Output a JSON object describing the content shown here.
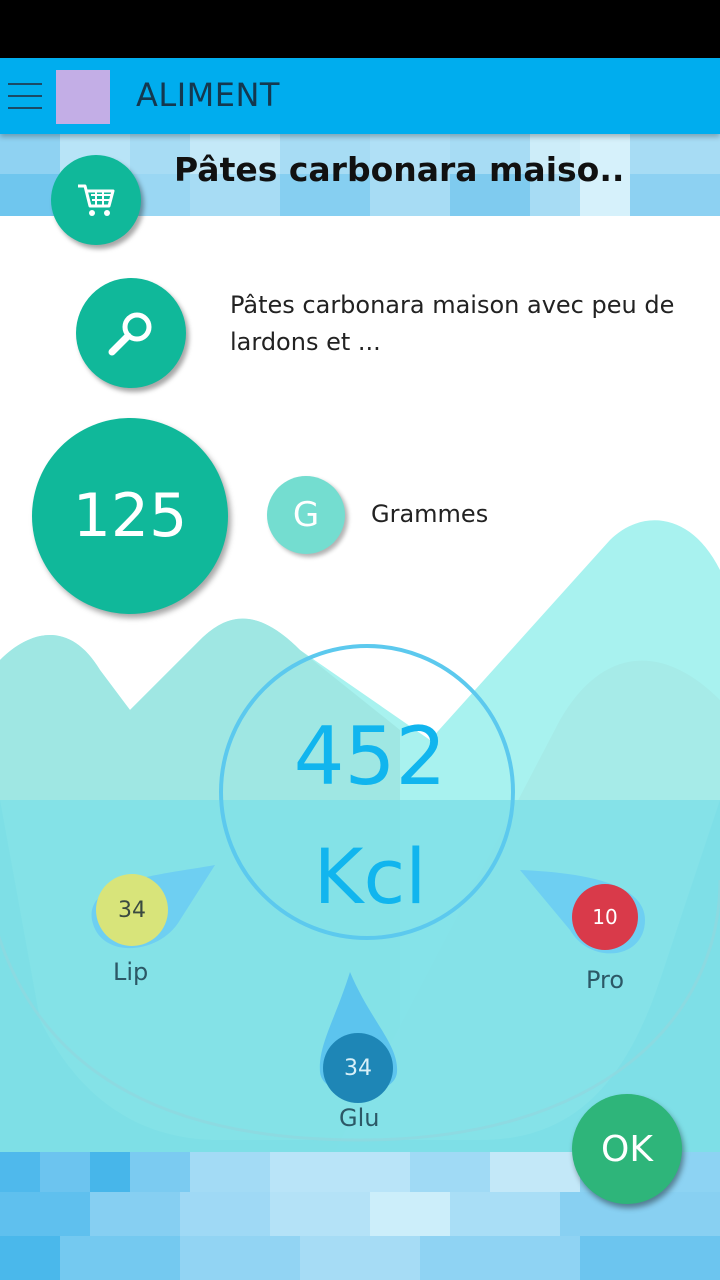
{
  "app_bar": {
    "title": "ALIMENT"
  },
  "food": {
    "title": "Pâtes carbonara maiso..",
    "description": "Pâtes carbonara maison avec peu de lardons et ..."
  },
  "quantity": {
    "value": "125",
    "unit_symbol": "G",
    "unit_label": "Grammes"
  },
  "energy": {
    "value": "452",
    "unit": "Kcl"
  },
  "macros": {
    "lip": {
      "value": "34",
      "label": "Lip",
      "color": "#d8e47a"
    },
    "pro": {
      "value": "10",
      "label": "Pro",
      "color": "#d93a4a"
    },
    "glu": {
      "value": "34",
      "label": "Glu",
      "color": "#1e86b6"
    }
  },
  "actions": {
    "ok_label": "OK"
  },
  "icons": {
    "cart": "cart-icon",
    "search": "search-icon",
    "menu": "menu-icon"
  },
  "colors": {
    "accent": "#00adee",
    "primary": "#10b89a",
    "ok": "#2eb57a",
    "kcal": "#11b5ee"
  }
}
